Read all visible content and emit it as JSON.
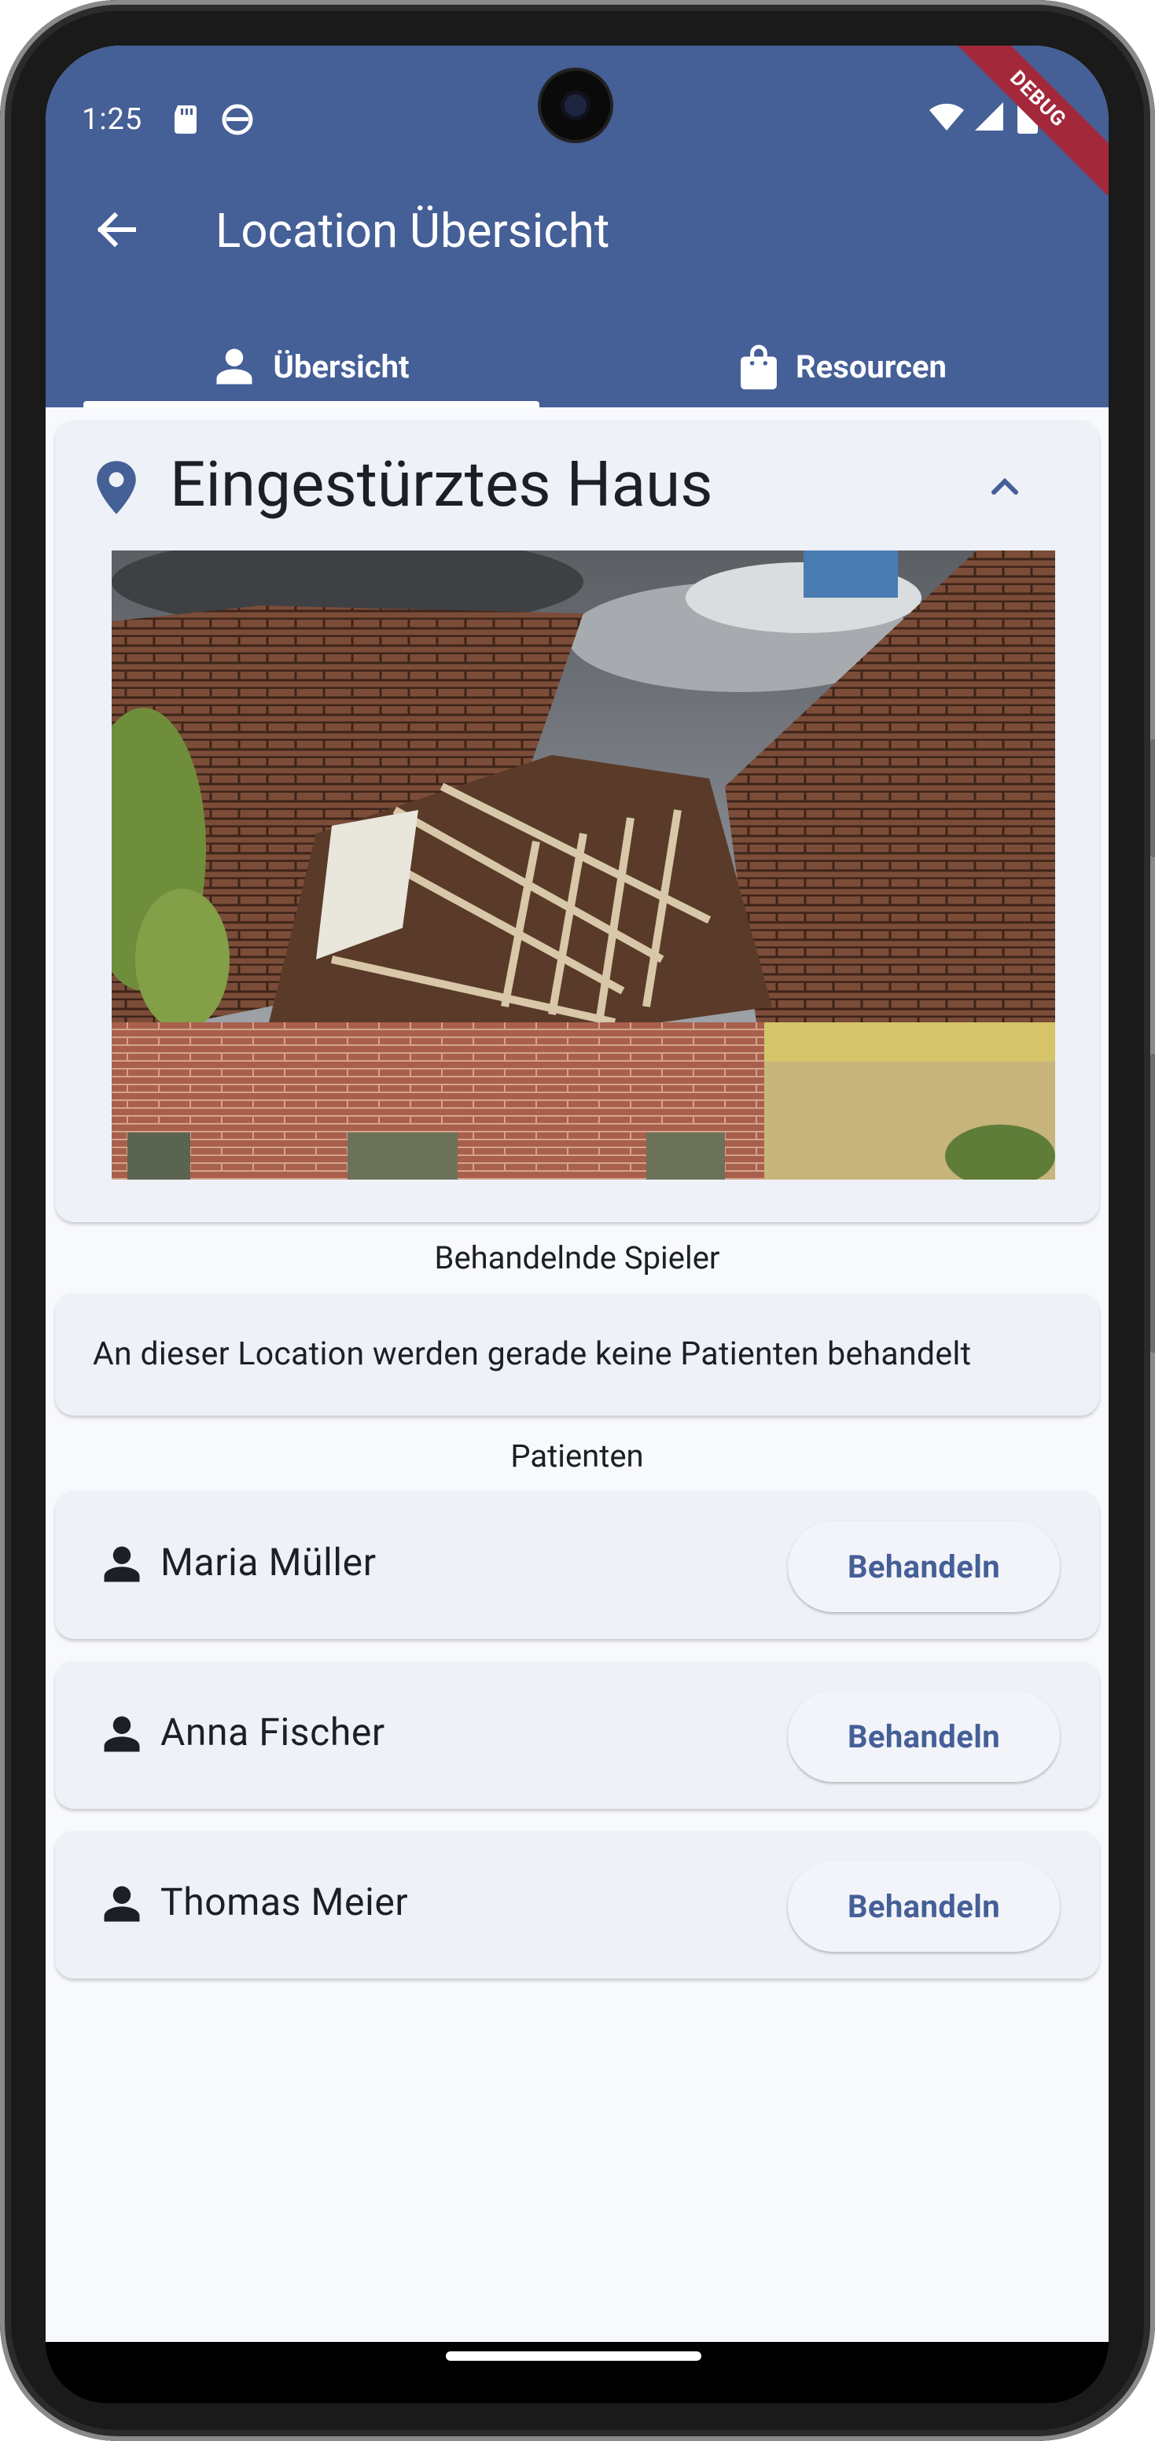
{
  "status_bar": {
    "time": "1:25",
    "debug_label": "DEBUG"
  },
  "app_bar": {
    "title": "Location Übersicht"
  },
  "tabs": [
    {
      "label": "Übersicht",
      "icon": "person-icon",
      "selected": true
    },
    {
      "label": "Resourcen",
      "icon": "shopping-bag-icon",
      "selected": false
    }
  ],
  "location": {
    "name": "Eingestürztes Haus",
    "icon": "location-pin-icon",
    "expanded": true,
    "image_alt": "collapsed-house-photo"
  },
  "treating_players": {
    "heading": "Behandelnde Spieler",
    "empty_message": "An dieser Location werden gerade keine Patienten behandelt"
  },
  "patients": {
    "heading": "Patienten",
    "items": [
      {
        "name": "Maria Müller",
        "action": "Behandeln"
      },
      {
        "name": "Anna Fischer",
        "action": "Behandeln"
      },
      {
        "name": "Thomas Meier",
        "action": "Behandeln"
      }
    ]
  },
  "colors": {
    "primary": "#455f97",
    "background": "#f8f9fd",
    "card": "#eef1f7",
    "debug": "#a3283a"
  }
}
